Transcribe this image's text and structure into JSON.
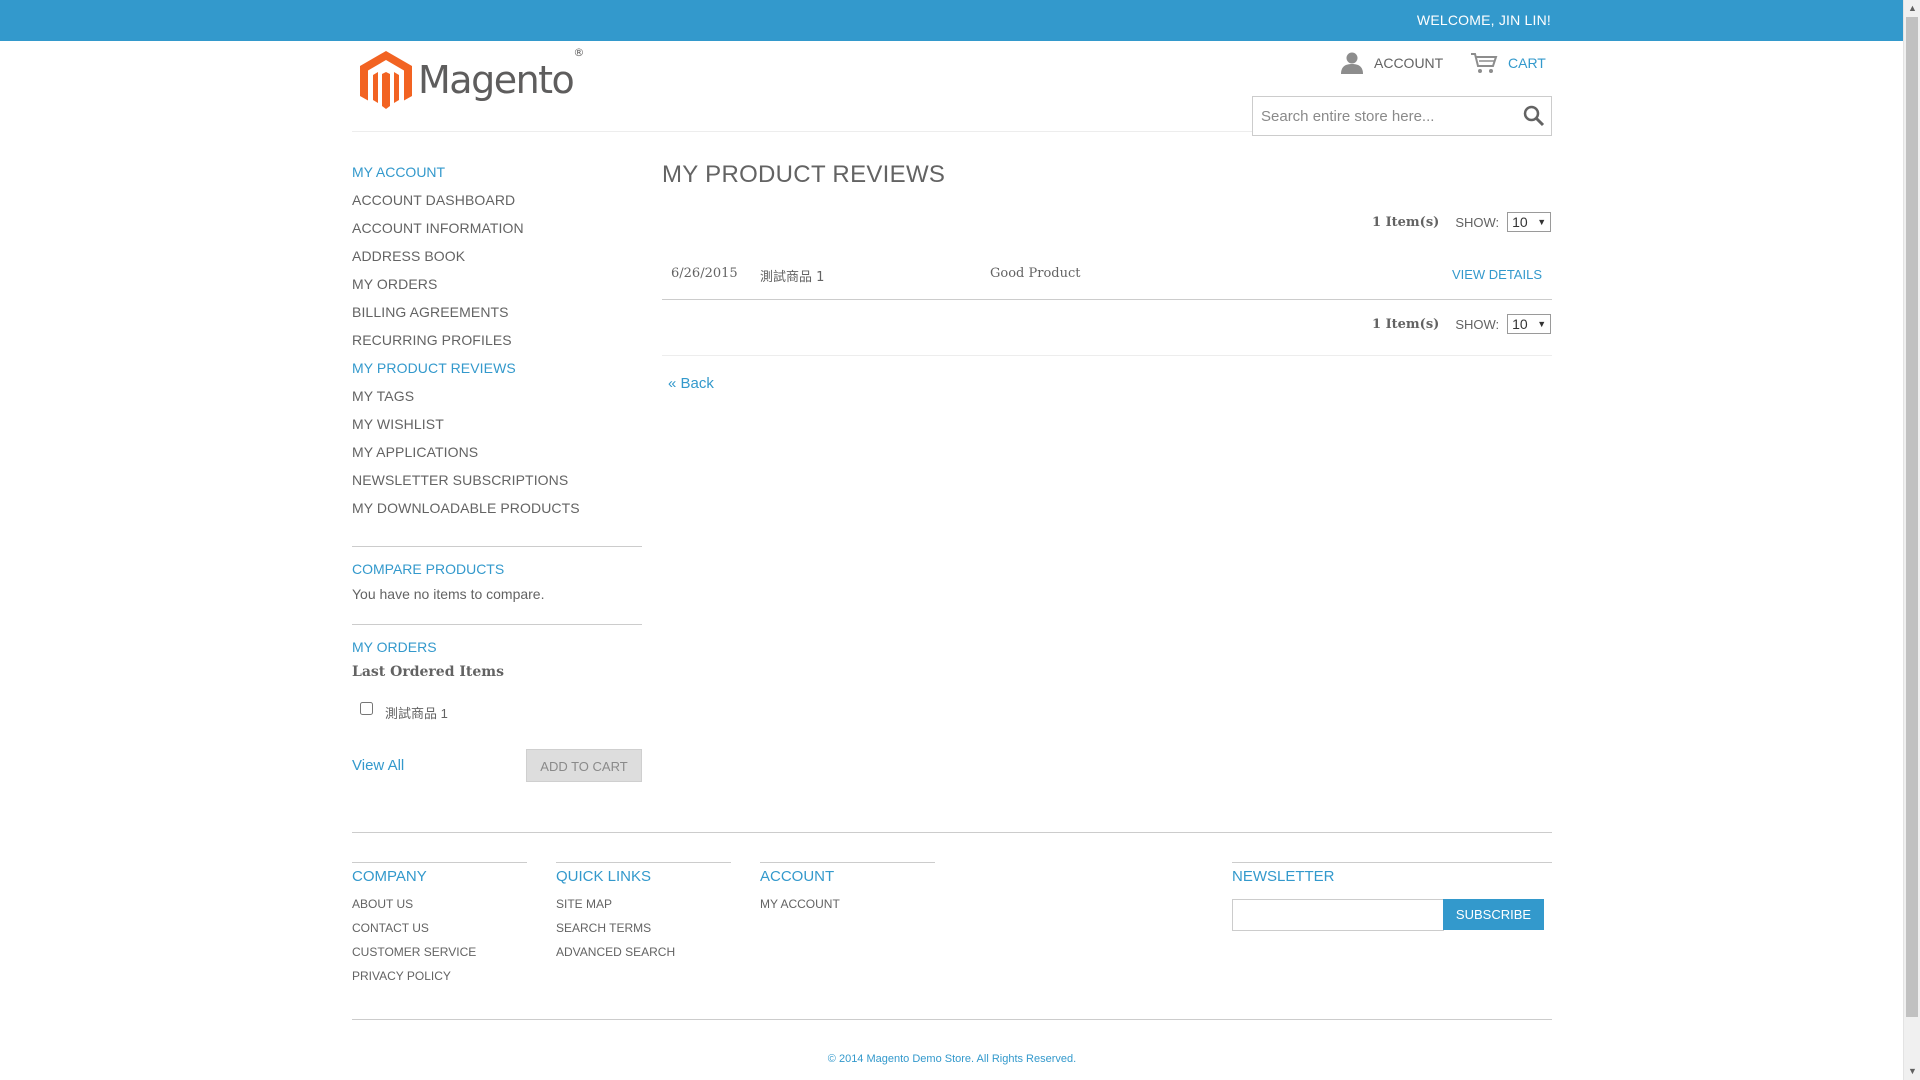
{
  "topbar": {
    "welcome": "WELCOME, JIN LIN!"
  },
  "header": {
    "logo_text": "Magento",
    "logo_reg": "®",
    "account_label": "ACCOUNT",
    "cart_label": "CART",
    "search_placeholder": "Search entire store here..."
  },
  "sidebar": {
    "account_title": "MY ACCOUNT",
    "items": [
      {
        "label": "ACCOUNT DASHBOARD",
        "active": false
      },
      {
        "label": "ACCOUNT INFORMATION",
        "active": false
      },
      {
        "label": "ADDRESS BOOK",
        "active": false
      },
      {
        "label": "MY ORDERS",
        "active": false
      },
      {
        "label": "BILLING AGREEMENTS",
        "active": false
      },
      {
        "label": "RECURRING PROFILES",
        "active": false
      },
      {
        "label": "MY PRODUCT REVIEWS",
        "active": true
      },
      {
        "label": "MY TAGS",
        "active": false
      },
      {
        "label": "MY WISHLIST",
        "active": false
      },
      {
        "label": "MY APPLICATIONS",
        "active": false
      },
      {
        "label": "NEWSLETTER SUBSCRIPTIONS",
        "active": false
      },
      {
        "label": "MY DOWNLOADABLE PRODUCTS",
        "active": false
      }
    ],
    "compare_title": "COMPARE PRODUCTS",
    "compare_msg": "You have no items to compare.",
    "orders_title": "MY ORDERS",
    "orders_sub": "Last Ordered Items",
    "ordered_item": "測試商品 1",
    "view_all": "View All",
    "add_to_cart": "ADD TO CART"
  },
  "main": {
    "title": "MY PRODUCT REVIEWS",
    "item_count": "1 Item(s)",
    "show_label": "SHOW:",
    "show_value": "10",
    "reviews": [
      {
        "date": "6/26/2015",
        "product": "測試商品 1",
        "review": "Good Product",
        "action": "VIEW DETAILS"
      }
    ],
    "back": "« Back"
  },
  "footer": {
    "company_title": "COMPANY",
    "company_links": [
      "ABOUT US",
      "CONTACT US",
      "CUSTOMER SERVICE",
      "PRIVACY POLICY"
    ],
    "quick_title": "QUICK LINKS",
    "quick_links": [
      "SITE MAP",
      "SEARCH TERMS",
      "ADVANCED SEARCH"
    ],
    "account_title": "ACCOUNT",
    "account_links": [
      "MY ACCOUNT"
    ],
    "newsletter_title": "NEWSLETTER",
    "subscribe": "SUBSCRIBE",
    "copyright": "© 2014 Magento Demo Store. All Rights Reserved."
  },
  "colors": {
    "accent": "#3399cc",
    "text": "#636363",
    "logo_orange": "#f26322"
  },
  "icons": [
    "user-icon",
    "cart-icon",
    "search-icon",
    "magento-logo-icon"
  ]
}
